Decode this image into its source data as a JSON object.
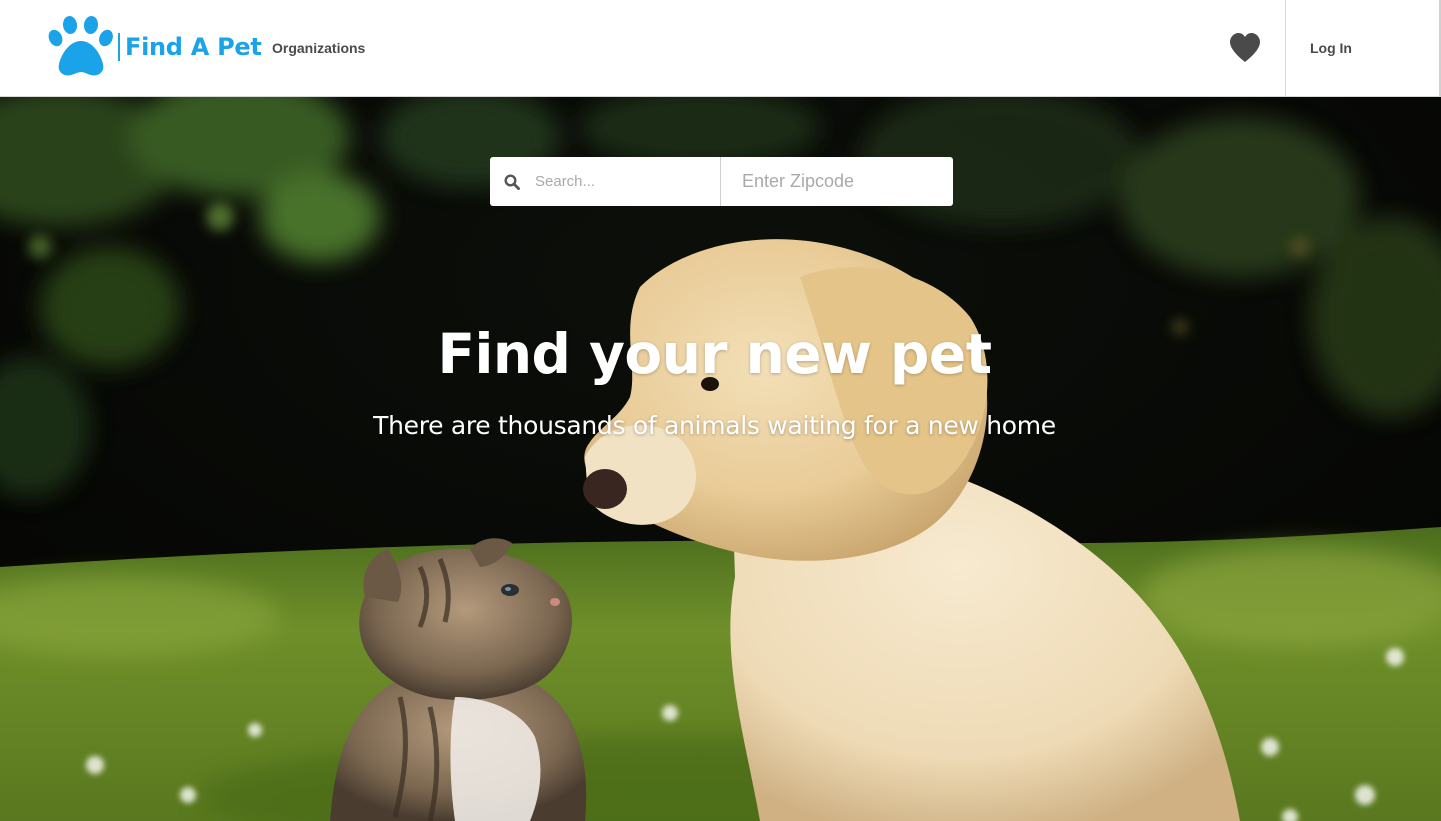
{
  "brand": {
    "name": "Find A Pet",
    "color": "#1aa3e8",
    "icon": "paw-icon"
  },
  "nav": {
    "organizations_label": "Organizations",
    "favorites_icon": "heart-icon",
    "login_label": "Log In"
  },
  "search": {
    "icon": "search-icon",
    "query_placeholder": "Search...",
    "query_value": "",
    "zip_placeholder": "Enter Zipcode",
    "zip_value": ""
  },
  "hero": {
    "title": "Find your new pet",
    "subtitle": "There are thousands of animals waiting for a new home",
    "background_image": "puppy and kitten on grass"
  }
}
